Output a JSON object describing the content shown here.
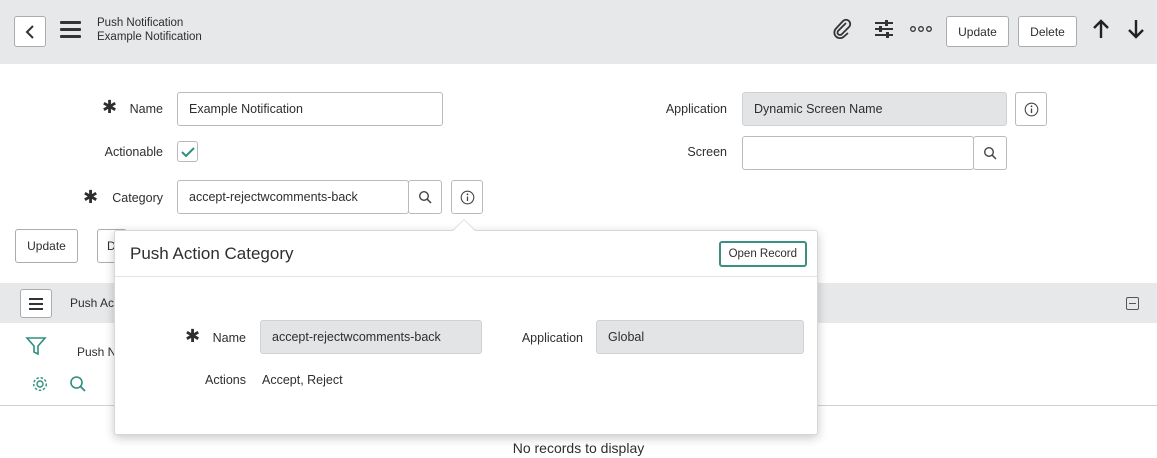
{
  "header": {
    "title_line1": "Push Notification",
    "title_line2": "Example Notification",
    "update_label": "Update",
    "delete_label": "Delete"
  },
  "form": {
    "name_label": "Name",
    "name_value": "Example Notification",
    "actionable_label": "Actionable",
    "actionable_checked": true,
    "category_label": "Category",
    "category_value": "accept-rejectwcomments-back",
    "application_label": "Application",
    "application_value": "Dynamic Screen Name",
    "screen_label": "Screen",
    "screen_value": ""
  },
  "actions": {
    "update_label": "Update",
    "delete_partial": "D"
  },
  "related_list": {
    "title_partial": "Push Ac",
    "filter_partial": "Push N",
    "empty_text": "No records to display"
  },
  "popover": {
    "title": "Push Action Category",
    "open_record_label": "Open Record",
    "name_label": "Name",
    "name_value": "accept-rejectwcomments-back",
    "application_label": "Application",
    "application_value": "Global",
    "actions_label": "Actions",
    "actions_value": "Accept, Reject"
  },
  "colors": {
    "accent_teal": "#3b8f83",
    "header_bg": "#e6e8ea",
    "readonly_bg": "#e3e4e5"
  }
}
